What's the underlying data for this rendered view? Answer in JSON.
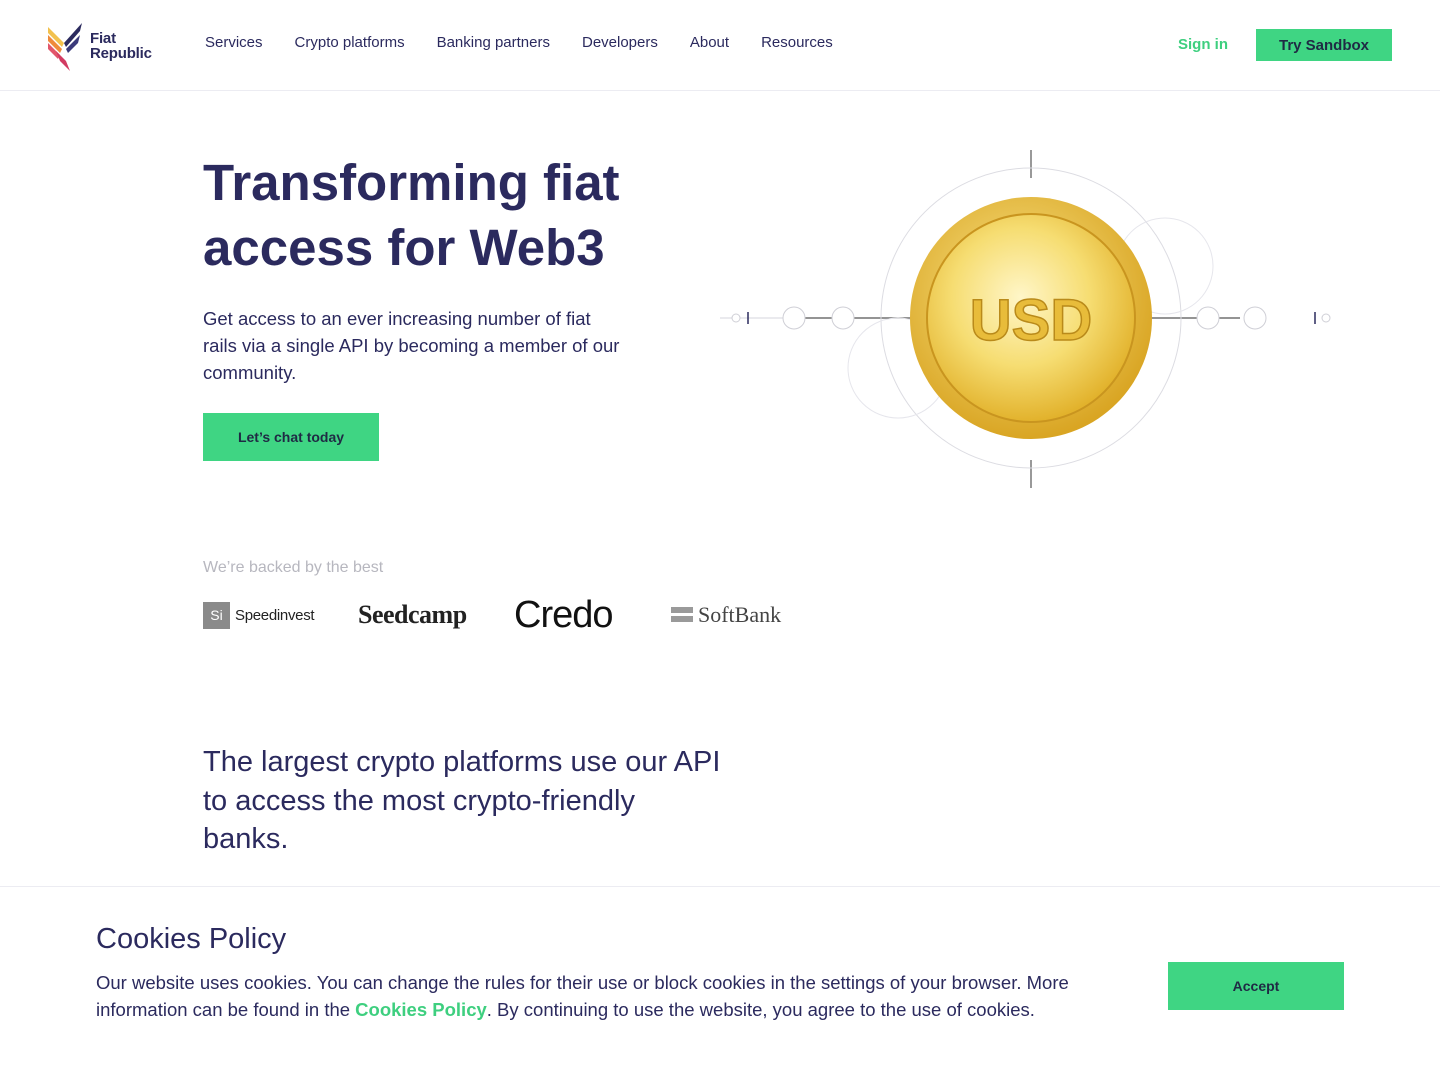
{
  "header": {
    "logo": {
      "line1": "Fiat",
      "line2": "Republic"
    },
    "nav": [
      "Services",
      "Crypto platforms",
      "Banking partners",
      "Developers",
      "About",
      "Resources"
    ],
    "sign_in": "Sign in",
    "try_sandbox": "Try Sandbox"
  },
  "hero": {
    "title_line1": "Transforming fiat",
    "title_line2": "access for Web3",
    "subtitle": "Get access to an ever increasing number of fiat rails via a single API by becoming a member of our community.",
    "cta": "Let’s chat today",
    "coin_label": "USD"
  },
  "backers": {
    "label": "We’re backed by the best",
    "logos": [
      {
        "mark": "Si",
        "name": "Speedinvest"
      },
      {
        "name": "Seedcamp"
      },
      {
        "name": "Credo"
      },
      {
        "name": "SoftBank"
      }
    ]
  },
  "section2": {
    "heading": "The largest crypto platforms use our API to access the most crypto-friendly banks."
  },
  "cookie": {
    "title": "Cookies Policy",
    "text_before": "Our website uses cookies. You can change the rules for their use or block cookies in the settings of your browser. More information can be found in the ",
    "link": "Cookies Policy",
    "text_after": ". By continuing to use the website, you agree to the use of cookies.",
    "accept": "Accept"
  },
  "colors": {
    "navy": "#2b2a5e",
    "green": "#3fd583",
    "coin_gold": "#f2d25a"
  }
}
